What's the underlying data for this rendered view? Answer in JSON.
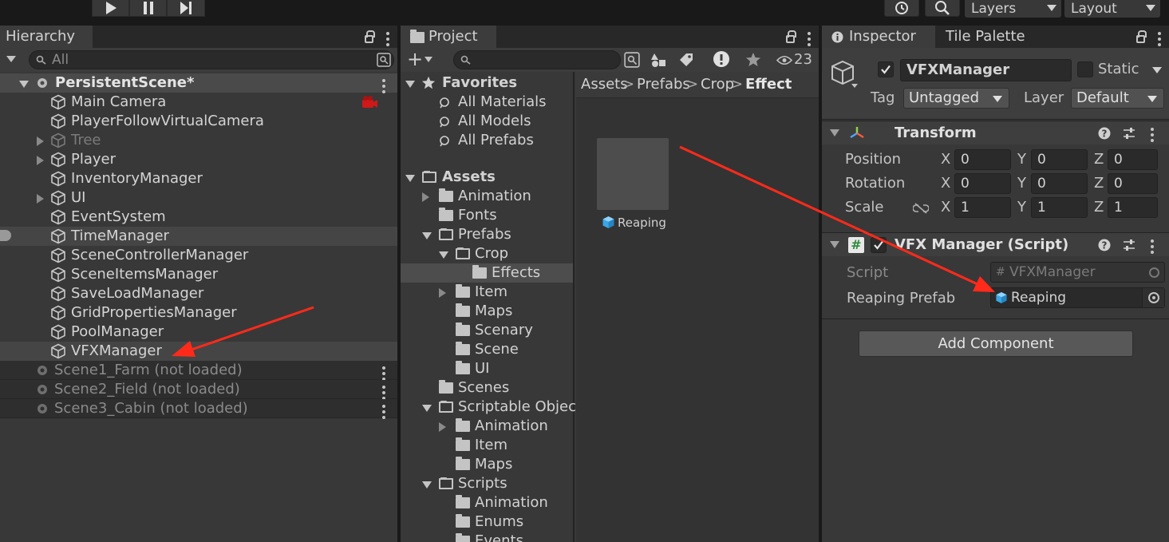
{
  "toolbar": {
    "layers_label": "Layers",
    "layout_label": "Layout"
  },
  "hierarchy": {
    "tab_label": "Hierarchy",
    "search_placeholder": "All",
    "scene": "PersistentScene*",
    "items": [
      {
        "label": "Main Camera"
      },
      {
        "label": "PlayerFollowVirtualCamera"
      },
      {
        "label": "Tree"
      },
      {
        "label": "Player"
      },
      {
        "label": "InventoryManager"
      },
      {
        "label": "UI"
      },
      {
        "label": "EventSystem"
      },
      {
        "label": "TimeManager"
      },
      {
        "label": "SceneControllerManager"
      },
      {
        "label": "SceneItemsManager"
      },
      {
        "label": "SaveLoadManager"
      },
      {
        "label": "GridPropertiesManager"
      },
      {
        "label": "PoolManager"
      },
      {
        "label": "VFXManager"
      }
    ],
    "other_scenes": [
      {
        "label": "Scene1_Farm (not loaded)"
      },
      {
        "label": "Scene2_Field (not loaded)"
      },
      {
        "label": "Scene3_Cabin (not loaded)"
      }
    ]
  },
  "project": {
    "tab_label": "Project",
    "hidden_count": "23",
    "favorites_label": "Favorites",
    "favorites": [
      {
        "label": "All Materials"
      },
      {
        "label": "All Models"
      },
      {
        "label": "All Prefabs"
      }
    ],
    "assets_label": "Assets",
    "tree": [
      {
        "label": "Animation"
      },
      {
        "label": "Fonts"
      },
      {
        "label": "Prefabs"
      },
      {
        "label": "Crop"
      },
      {
        "label": "Effects"
      },
      {
        "label": "Item"
      },
      {
        "label": "Maps"
      },
      {
        "label": "Scenary"
      },
      {
        "label": "Scene"
      },
      {
        "label": "UI"
      },
      {
        "label": "Scenes"
      },
      {
        "label": "Scriptable Objec"
      },
      {
        "label": "Animation"
      },
      {
        "label": "Item"
      },
      {
        "label": "Maps"
      },
      {
        "label": "Scripts"
      },
      {
        "label": "Animation"
      },
      {
        "label": "Enums"
      },
      {
        "label": "Events"
      }
    ],
    "breadcrumb": [
      "Assets",
      "Prefabs",
      "Crop",
      "Effect"
    ],
    "asset_item": "Reaping"
  },
  "inspector": {
    "tab_label": "Inspector",
    "tab2_label": "Tile Palette",
    "object_name": "VFXManager",
    "static_label": "Static",
    "tag_label": "Tag",
    "tag_value": "Untagged",
    "layer_label": "Layer",
    "layer_value": "Default",
    "transform_title": "Transform",
    "position_label": "Position",
    "rotation_label": "Rotation",
    "scale_label": "Scale",
    "position": {
      "x": "0",
      "y": "0",
      "z": "0"
    },
    "rotation": {
      "x": "0",
      "y": "0",
      "z": "0"
    },
    "scale": {
      "x": "1",
      "y": "1",
      "z": "1"
    },
    "axis": {
      "x": "X",
      "y": "Y",
      "z": "Z"
    },
    "script_component_title": "VFX Manager (Script)",
    "script_label": "Script",
    "script_value": "VFXManager",
    "reaping_prefab_label": "Reaping Prefab",
    "reaping_prefab_value": "Reaping",
    "add_component_label": "Add Component"
  },
  "colors": {
    "panel_bg": "#383838",
    "selected_row": "#4d4d4d",
    "annotation_arrow": "#ff2a1a",
    "prefab_blue": "#5fb9f0"
  }
}
